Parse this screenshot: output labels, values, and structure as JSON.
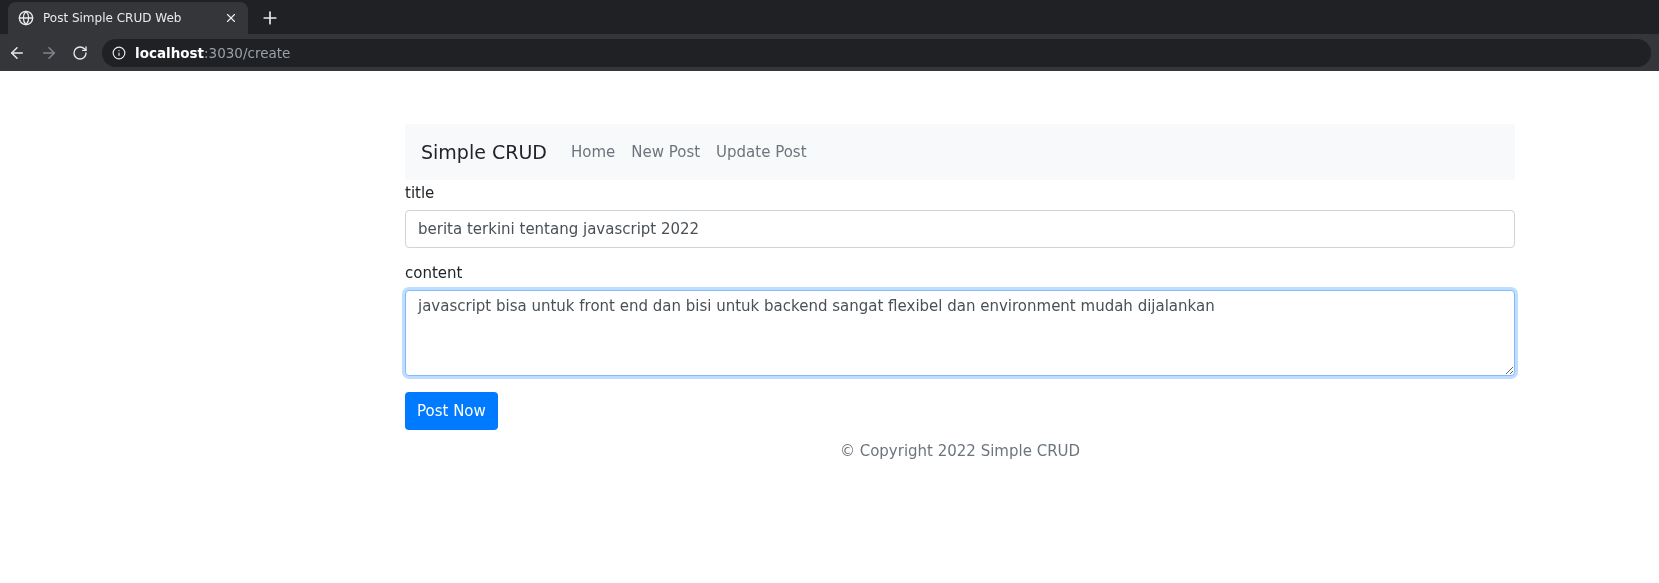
{
  "browser": {
    "tab_title": "Post Simple CRUD Web",
    "url_host": "localhost",
    "url_path": ":3030/create"
  },
  "navbar": {
    "brand": "Simple CRUD",
    "links": [
      {
        "label": "Home"
      },
      {
        "label": "New Post"
      },
      {
        "label": "Update Post"
      }
    ]
  },
  "form": {
    "title_label": "title",
    "title_value": "berita terkini tentang javascript 2022",
    "content_label": "content",
    "content_value": "javascript bisa untuk front end dan bisi untuk backend sangat flexibel dan environment mudah dijalankan",
    "submit": "Post Now"
  },
  "footer": "© Copyright 2022 Simple CRUD"
}
